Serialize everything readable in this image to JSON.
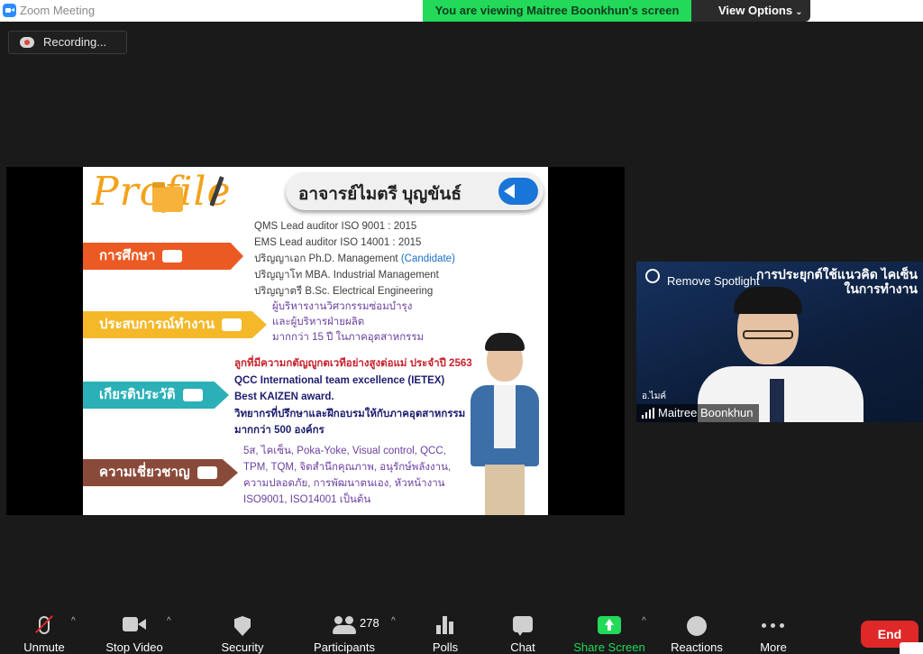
{
  "window": {
    "title": "Zoom Meeting"
  },
  "banner": {
    "viewing_text": "You are viewing Maitree Boonkhun's screen",
    "view_options_label": "View Options"
  },
  "recording": {
    "label": "Recording..."
  },
  "slide": {
    "profile_word": "Profile",
    "name": "อาจารย์ไมตรี บุญขันธ์",
    "education": {
      "label": "การศึกษา",
      "lines": [
        "QMS Lead auditor ISO 9001 : 2015",
        "EMS  Lead auditor ISO 14001 : 2015",
        "ปริญญาเอก Ph.D. Management",
        "ปริญญาโท MBA. Industrial Management",
        "ปริญญาตรี B.Sc. Electrical Engineering"
      ],
      "candidate": "(Candidate)"
    },
    "work": {
      "label": "ประสบการณ์ทำงาน",
      "lines": [
        "ผู้บริหารงานวิศวกรรมซ่อมบำรุง",
        "และผู้บริหารฝ่ายผลิต",
        "มากกว่า 15 ปี ในภาคอุตสาหกรรม"
      ]
    },
    "honors": {
      "label": "เกียรติประวัติ",
      "line1": "ลูกที่มีความกตัญญูกตเวทีอย่างสูงต่อแม่ ประจำปี 2563",
      "line2": "QCC International team excellence (IETEX)",
      "line3": "Best KAIZEN award.",
      "line4": "วิทยากรที่ปรึกษาและฝึกอบรมให้กับภาคอุตสาหกรรม",
      "line5": "มากกว่า 500 องค์กร"
    },
    "expertise": {
      "label": "ความเชี่ยวชาญ",
      "lines": [
        "5ส, ไคเซ็น, Poka-Yoke, Visual control, QCC,",
        "TPM, TQM, จิตสำนึกคุณภาพ, อนุรักษ์พลังงาน,",
        "ความปลอดภัย, การพัฒนาตนเอง, หัวหน้างาน",
        "ISO9001, ISO14001 เป็นต้น"
      ]
    }
  },
  "spotlight": {
    "remove_label": "Remove Spotlight",
    "video_title_line1": "การประยุกต์ใช้แนวคิด ไคเซ็น",
    "video_title_line2": "ในการทำงาน",
    "sub_name": "อ.ไมค์",
    "participant_name": "Maitree Boonkhun"
  },
  "toolbar": {
    "unmute": "Unmute",
    "stop_video": "Stop Video",
    "security": "Security",
    "participants": "Participants",
    "participants_count": "278",
    "polls": "Polls",
    "chat": "Chat",
    "share_screen": "Share Screen",
    "reactions": "Reactions",
    "more": "More",
    "end": "End"
  },
  "colors": {
    "share_green": "#23d959",
    "end_red": "#e02828",
    "zoom_blue": "#2d8cff"
  }
}
